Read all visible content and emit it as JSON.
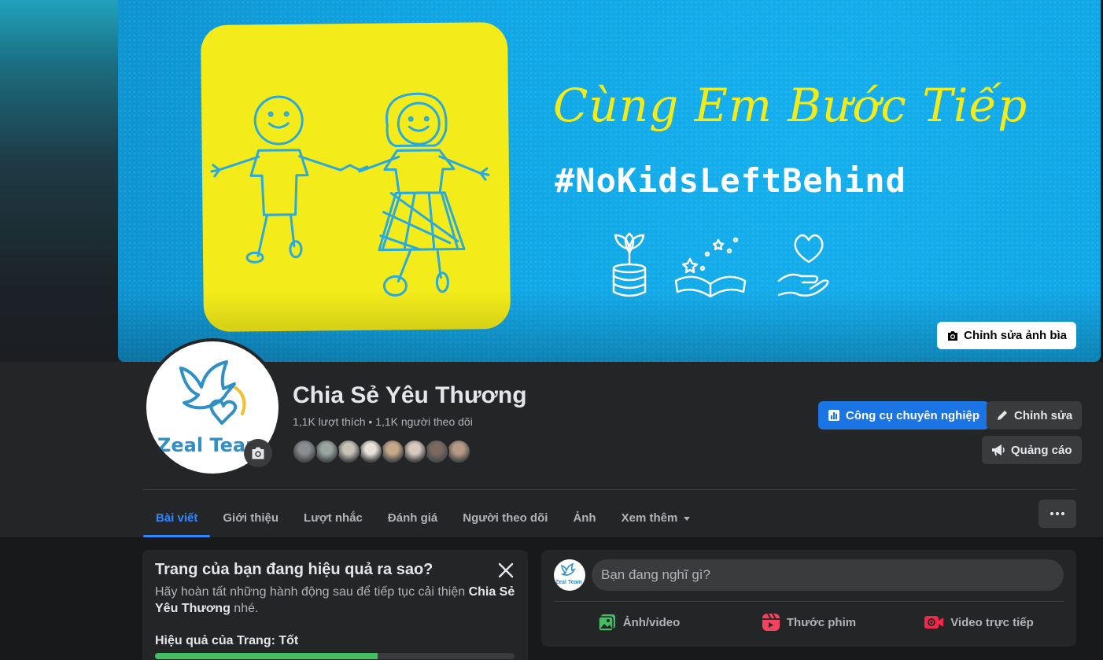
{
  "cover": {
    "slogan": "Cùng Em Bước Tiếp",
    "hashtag": "#NoKidsLeftBehind",
    "edit_cover_label": "Chỉnh sửa ảnh bìa"
  },
  "profile": {
    "logo_text": "Zeal Team",
    "page_name": "Chia Sẻ Yêu Thương",
    "stats": "1,1K lượt thích • 1,1K người theo dõi",
    "follower_avatar_colors": [
      "#8a8d91",
      "#9aa5a0",
      "#c9c2b6",
      "#e8e2da",
      "#c6a98a",
      "#d9c8bd",
      "#7a6a60",
      "#b79a86"
    ]
  },
  "actions": {
    "pro_tools_label": "Công cụ chuyên nghiệp",
    "edit_label": "Chỉnh sửa",
    "ads_label": "Quảng cáo"
  },
  "tabs": [
    {
      "label": "Bài viết",
      "active": true
    },
    {
      "label": "Giới thiệu",
      "active": false
    },
    {
      "label": "Lượt nhắc",
      "active": false
    },
    {
      "label": "Đánh giá",
      "active": false
    },
    {
      "label": "Người theo dõi",
      "active": false
    },
    {
      "label": "Ảnh",
      "active": false
    },
    {
      "label": "Xem thêm",
      "active": false
    }
  ],
  "insights": {
    "title": "Trang của bạn đang hiệu quả ra sao?",
    "desc_prefix": "Hãy hoàn tất những hành động sau để tiếp tục cải thiện ",
    "desc_page_name": "Chia Sẻ Yêu Thương",
    "desc_suffix": " nhé.",
    "performance_label": "Hiệu quả của Trang: Tốt",
    "performance_fraction": 0.62
  },
  "composer": {
    "placeholder": "Bạn đang nghĩ gì?",
    "avatar_text": "Zeal Team",
    "actions": [
      {
        "label": "Ảnh/video",
        "icon": "photo-video-icon",
        "color": "#45bd62"
      },
      {
        "label": "Thước phim",
        "icon": "reels-icon",
        "color": "#f3425f"
      },
      {
        "label": "Video trực tiếp",
        "icon": "live-video-icon",
        "color": "#f02849"
      }
    ]
  },
  "colors": {
    "accent": "#1b74e4",
    "cover_blue": "#11a5e4",
    "cover_yellow": "#f3ec1a"
  }
}
